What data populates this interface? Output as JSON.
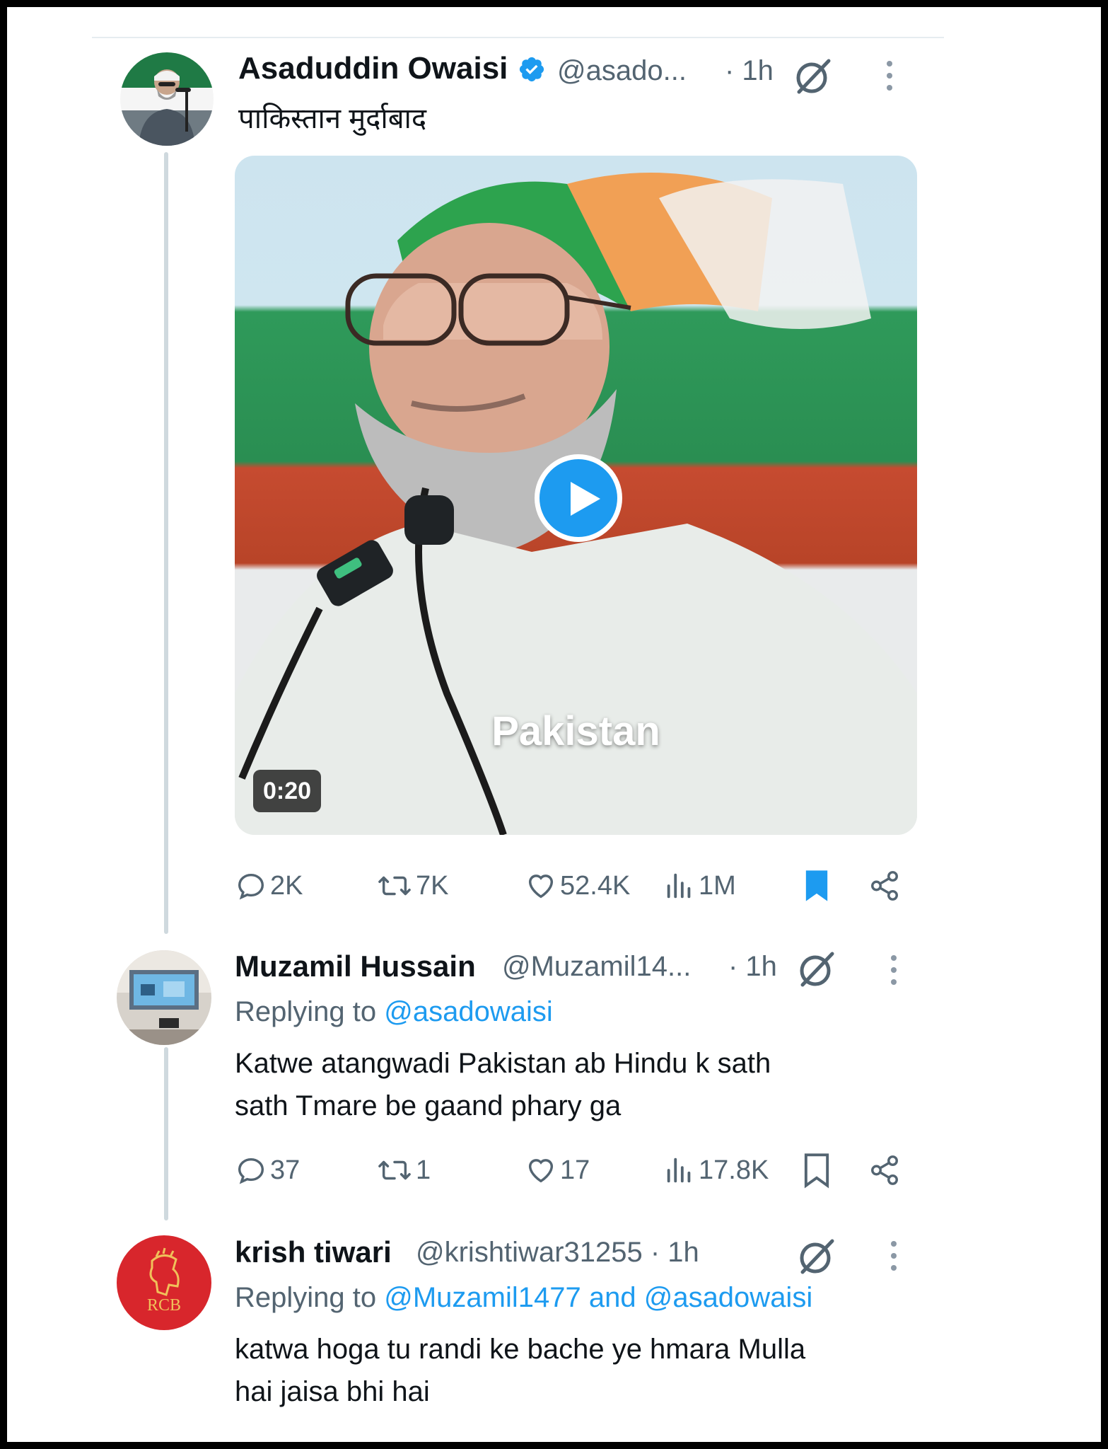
{
  "colors": {
    "accent": "#1d9bf0",
    "text_primary": "#0f1419",
    "text_secondary": "#536471",
    "thread_line": "#cfd9de"
  },
  "tweet": {
    "author_name": "Asaduddin Owaisi",
    "author_handle": "@asado...",
    "time": "· 1h",
    "verified": true,
    "text": "पाकिस्तान मुर्दाबाद",
    "media": {
      "type": "video",
      "caption": "Pakistan",
      "duration": "0:20"
    },
    "actions": {
      "replies": "2K",
      "reposts": "7K",
      "likes": "52.4K",
      "views": "1M",
      "bookmarked": true
    }
  },
  "replies": [
    {
      "author_name": "Muzamil Hussain",
      "author_handle": "@Muzamil14...",
      "time": "· 1h",
      "replying_label": "Replying to",
      "replying_handles": "@asadowaisi",
      "text_line1": "Katwe atangwadi Pakistan ab Hindu k sath",
      "text_line2": "sath Tmare be gaand phary ga",
      "actions": {
        "replies": "37",
        "reposts": "1",
        "likes": "17",
        "views": "17.8K",
        "bookmarked": false
      }
    },
    {
      "author_name": "krish tiwari",
      "author_handle": "@krishtiwar31255 · 1h",
      "time": "",
      "replying_label": "Replying to",
      "replying_handles": "@Muzamil1477 and @asadowaisi",
      "text_line1": "katwa hoga tu randi ke bache ye hmara Mulla",
      "text_line2": "hai jaisa bhi hai",
      "avatar_logo": "RCB"
    }
  ],
  "icons": {
    "verified": "verified-badge-icon",
    "grok": "grok-icon",
    "more": "more-vertical-icon",
    "reply": "reply-icon",
    "repost": "repost-icon",
    "like": "heart-icon",
    "views": "views-icon",
    "bookmark": "bookmark-icon",
    "share": "share-icon",
    "play": "play-icon"
  }
}
